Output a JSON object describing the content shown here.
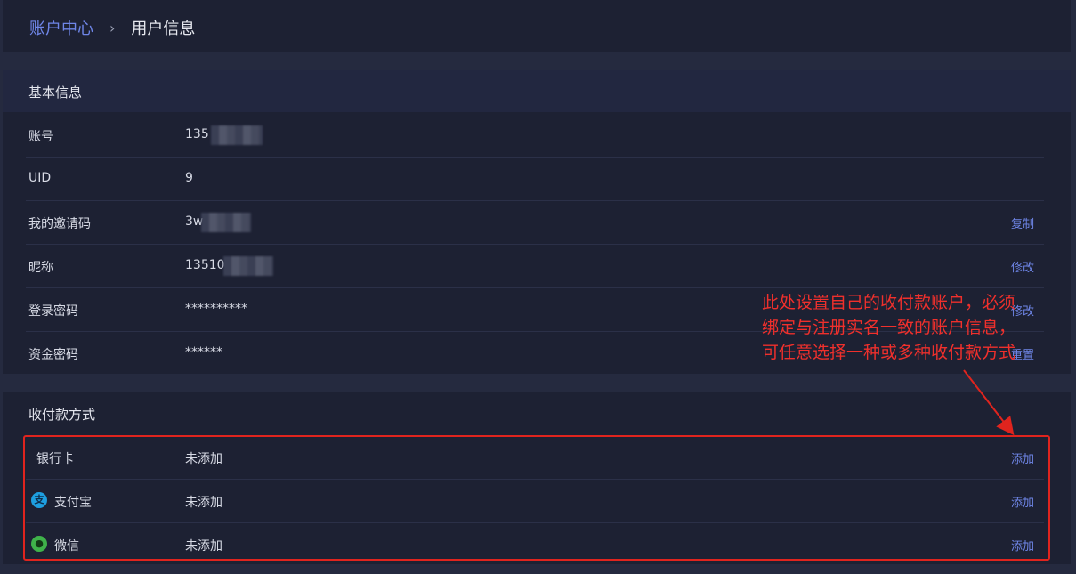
{
  "breadcrumb": {
    "root": "账户中心",
    "separator": "›",
    "current": "用户信息"
  },
  "basic_info": {
    "title": "基本信息",
    "rows": [
      {
        "label": "账号",
        "value": "135",
        "action": ""
      },
      {
        "label": "UID",
        "value": "9",
        "action": ""
      },
      {
        "label": "我的邀请码",
        "value": "3w",
        "action": "复制"
      },
      {
        "label": "昵称",
        "value": "13510",
        "action": "修改"
      },
      {
        "label": "登录密码",
        "value": "**********",
        "action": "修改"
      },
      {
        "label": "资金密码",
        "value": "******",
        "action": "重置"
      }
    ]
  },
  "payment": {
    "title": "收付款方式",
    "rows": [
      {
        "label": "银行卡",
        "value": "未添加",
        "action": "添加",
        "icon": ""
      },
      {
        "label": "支付宝",
        "value": "未添加",
        "action": "添加",
        "icon": "alipay-icon"
      },
      {
        "label": "微信",
        "value": "未添加",
        "action": "添加",
        "icon": "wechat-icon"
      }
    ]
  },
  "annotation": "此处设置自己的收付款账户，必须绑定与注册实名一致的账户信息，可任意选择一种或多种收付款方式",
  "colors": {
    "accent": "#6f86e8",
    "annotation": "#e0241e",
    "panel": "#1d2133",
    "background": "#252a3f"
  }
}
